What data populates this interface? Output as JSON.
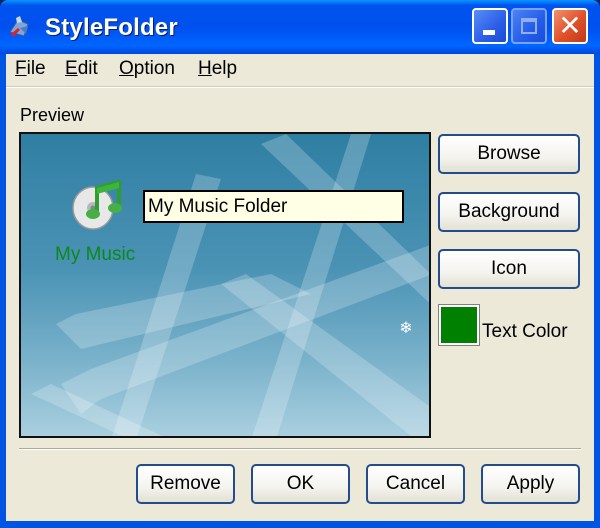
{
  "window": {
    "title": "StyleFolder",
    "app_icon": "stylefolder-app-icon",
    "controls": {
      "minimize_icon": "minimize-icon",
      "maximize_icon": "maximize-icon",
      "close_icon": "close-icon",
      "close_glyph": "✕"
    }
  },
  "menu": {
    "items": [
      {
        "accel": "F",
        "rest": "ile"
      },
      {
        "accel": "E",
        "rest": "dit"
      },
      {
        "accel": "O",
        "rest": "ption"
      },
      {
        "accel": "H",
        "rest": "elp"
      }
    ]
  },
  "preview": {
    "label": "Preview",
    "folder_icon": "music-folder-icon",
    "folder_label": "My Music",
    "folder_label_color": "#0a8a1a",
    "name_input_value": "My Music Folder",
    "corner_glyph": "❄"
  },
  "side_buttons": {
    "browse": "Browse",
    "background": "Background",
    "icon": "Icon"
  },
  "text_color": {
    "label": "Text Color",
    "swatch_color": "#008000"
  },
  "bottom_buttons": {
    "remove": "Remove",
    "ok": "OK",
    "cancel": "Cancel",
    "apply": "Apply"
  }
}
